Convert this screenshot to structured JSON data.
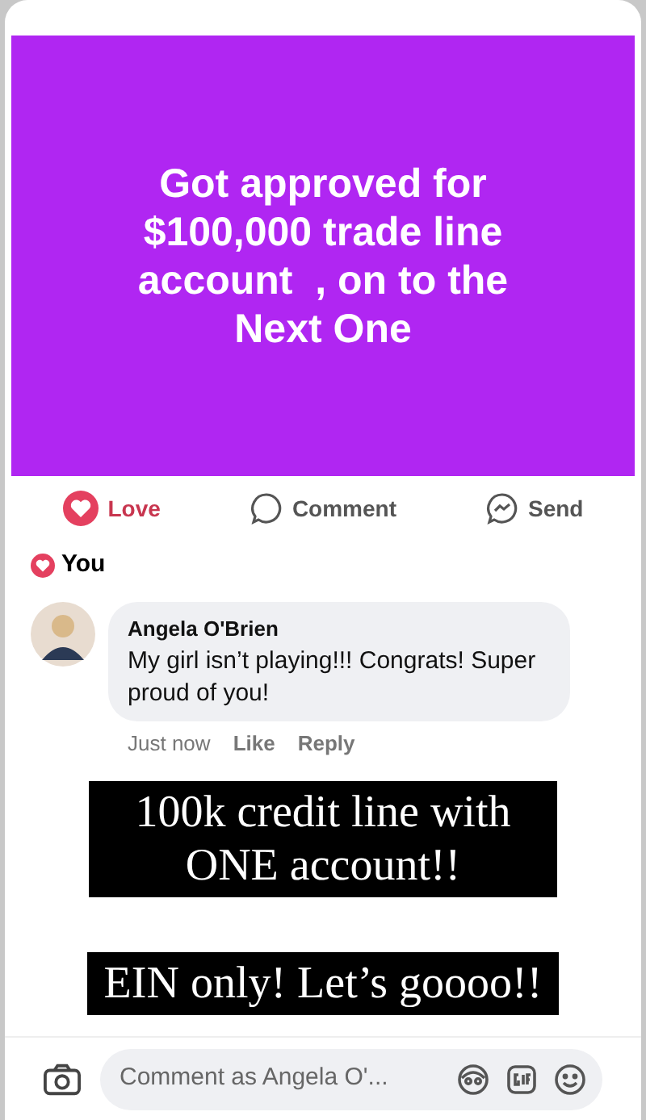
{
  "post": {
    "text": "Got approved for $100,000 trade line account  , on to the Next One"
  },
  "actions": [
    {
      "kind": "love",
      "label": "Love",
      "selected": true
    },
    {
      "kind": "comment",
      "label": "Comment",
      "selected": false
    },
    {
      "kind": "send",
      "label": "Send",
      "selected": false
    }
  ],
  "reactions": {
    "label": "You"
  },
  "comment": {
    "author": "Angela O'Brien",
    "text": "My girl isn’t playing!!! Congrats! Super proud of you!",
    "time": "Just now",
    "like": "Like",
    "reply": "Reply"
  },
  "captions": [
    "100k credit line with ONE account!!",
    "EIN only! Let’s goooo!!"
  ],
  "composer": {
    "placeholder": "Comment as Angela O'..."
  }
}
